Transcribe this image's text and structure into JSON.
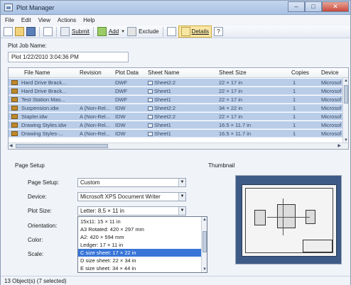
{
  "window": {
    "title": "Plot Manager",
    "buttons": [
      "–",
      "□",
      "✕"
    ]
  },
  "menu": [
    "File",
    "Edit",
    "View",
    "Actions",
    "Help"
  ],
  "toolbar": {
    "submit_label": "Submit",
    "add_label": "Add",
    "exclude_label": "Exclude",
    "details_label": "Details"
  },
  "job": {
    "label": "Plot Job Name:",
    "value": "Plot 1/22/2010 3:04:36 PM"
  },
  "grid": {
    "columns": [
      "File Name",
      "Revision",
      "Plot Data",
      "Sheet Name",
      "Sheet Size",
      "Copies",
      "Device"
    ],
    "rows": [
      {
        "file": "Hard Drive Brack...",
        "revision": "",
        "plot_data": "DWF",
        "sheet": "Sheet2:2",
        "size": "22 × 17 in",
        "copies": "1",
        "device": "Microsof"
      },
      {
        "file": "Hard Drive Brack...",
        "revision": "",
        "plot_data": "DWF",
        "sheet": "Sheet1",
        "size": "22 × 17 in",
        "copies": "1",
        "device": "Microsof"
      },
      {
        "file": "Test Station Mas...",
        "revision": "",
        "plot_data": "DWF",
        "sheet": "Sheet1",
        "size": "22 × 17 in",
        "copies": "1",
        "device": "Microsof"
      },
      {
        "file": "Suspension.idw",
        "revision": "A (Non-Rel...",
        "plot_data": "IDW",
        "sheet": "Sheet2:2",
        "size": "34 × 22 in",
        "copies": "1",
        "device": "Microsof"
      },
      {
        "file": "Stapler.idw",
        "revision": "A (Non-Rel...",
        "plot_data": "IDW",
        "sheet": "Sheet2:2",
        "size": "22 × 17 in",
        "copies": "1",
        "device": "Microsof"
      },
      {
        "file": "Drawing Styles.idw",
        "revision": "A (Non-Rel...",
        "plot_data": "IDW",
        "sheet": "Sheet1",
        "size": "16.5 × 11.7 in",
        "copies": "1",
        "device": "Microsof"
      },
      {
        "file": "Drawing Styles-...",
        "revision": "A (Non-Rel...",
        "plot_data": "IDW",
        "sheet": "Sheet1",
        "size": "16.5 × 11.7 in",
        "copies": "1",
        "device": "Microsof"
      }
    ]
  },
  "page_setup": {
    "section_label": "Page Setup",
    "thumbnail_label": "Thumbnail",
    "page_setup_label": "Page Setup:",
    "page_setup_value": "Custom",
    "device_label": "Device:",
    "device_value": "Microsoft XPS Document Writer",
    "plot_size_label": "Plot Size:",
    "plot_size_value": "Letter: 8.5 × 11 in",
    "orientation_label": "Orientation:",
    "color_label": "Color:",
    "scale_label": "Scale:",
    "plot_size_options": [
      "15x11: 15 × 11 in",
      "A3 Rotated: 420 × 297 mm",
      "A2: 420 × 594 mm",
      "Ledger: 17 × 11 in",
      "C size sheet: 17 × 22 in",
      "D size sheet: 22 × 34 in",
      "E size sheet: 34 × 44 in"
    ],
    "selected_option_index": 4
  },
  "status": {
    "text": "13 Object(s) (7 selected)"
  },
  "colors": {
    "selection_row": "#b9cde9",
    "dropdown_selection": "#3875d7",
    "thumbnail_bg": "#3e5a86"
  }
}
